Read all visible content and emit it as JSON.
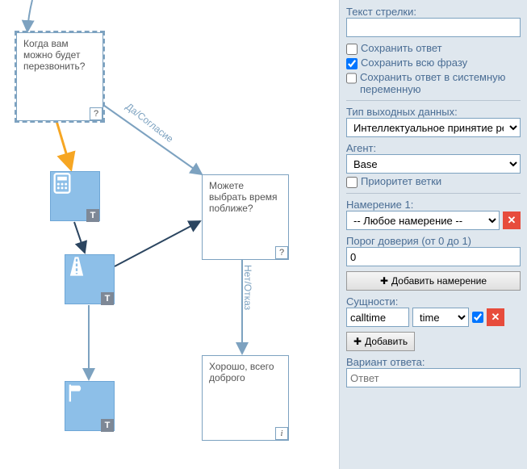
{
  "diagram": {
    "nodes": {
      "callback": {
        "text": "Когда вам можно будет перезвонить?",
        "corner": "?"
      },
      "choose_time": {
        "text": "Можете выбрать время поближе?",
        "corner": "?"
      },
      "goodbye": {
        "text": "Хорошо, всего доброго",
        "corner": "i"
      }
    },
    "edges": {
      "yes": "Да/Согласие",
      "no": "Нет/Отказ"
    },
    "blocks": {
      "calc_badge": "T",
      "road_badge": "T",
      "flag_badge": "T"
    }
  },
  "panel": {
    "arrow_text_label": "Текст стрелки:",
    "arrow_text_value": "",
    "save_answer": {
      "label": "Сохранить ответ",
      "checked": false
    },
    "save_phrase": {
      "label": "Сохранить всю фразу",
      "checked": true
    },
    "save_sysvar": {
      "label": "Сохранить ответ в системную переменную",
      "checked": false
    },
    "output_type_label": "Тип выходных данных:",
    "output_type_value": "Интеллектуальное принятие ре",
    "agent_label": "Агент:",
    "agent_value": "Base",
    "branch_priority": {
      "label": "Приоритет ветки",
      "checked": false
    },
    "intent_label": "Намерение 1:",
    "intent_value": "-- Любое намерение --",
    "threshold_label": "Порог доверия (от 0 до 1)",
    "threshold_value": "0",
    "add_intent_btn": "Добавить намерение",
    "entities_label": "Сущности:",
    "entity_name": "calltime",
    "entity_type": "time",
    "entity_checked": true,
    "add_btn": "Добавить",
    "answer_variant_label": "Вариант ответа:",
    "answer_variant_placeholder": "Ответ",
    "plus": "✚",
    "x": "✕"
  }
}
